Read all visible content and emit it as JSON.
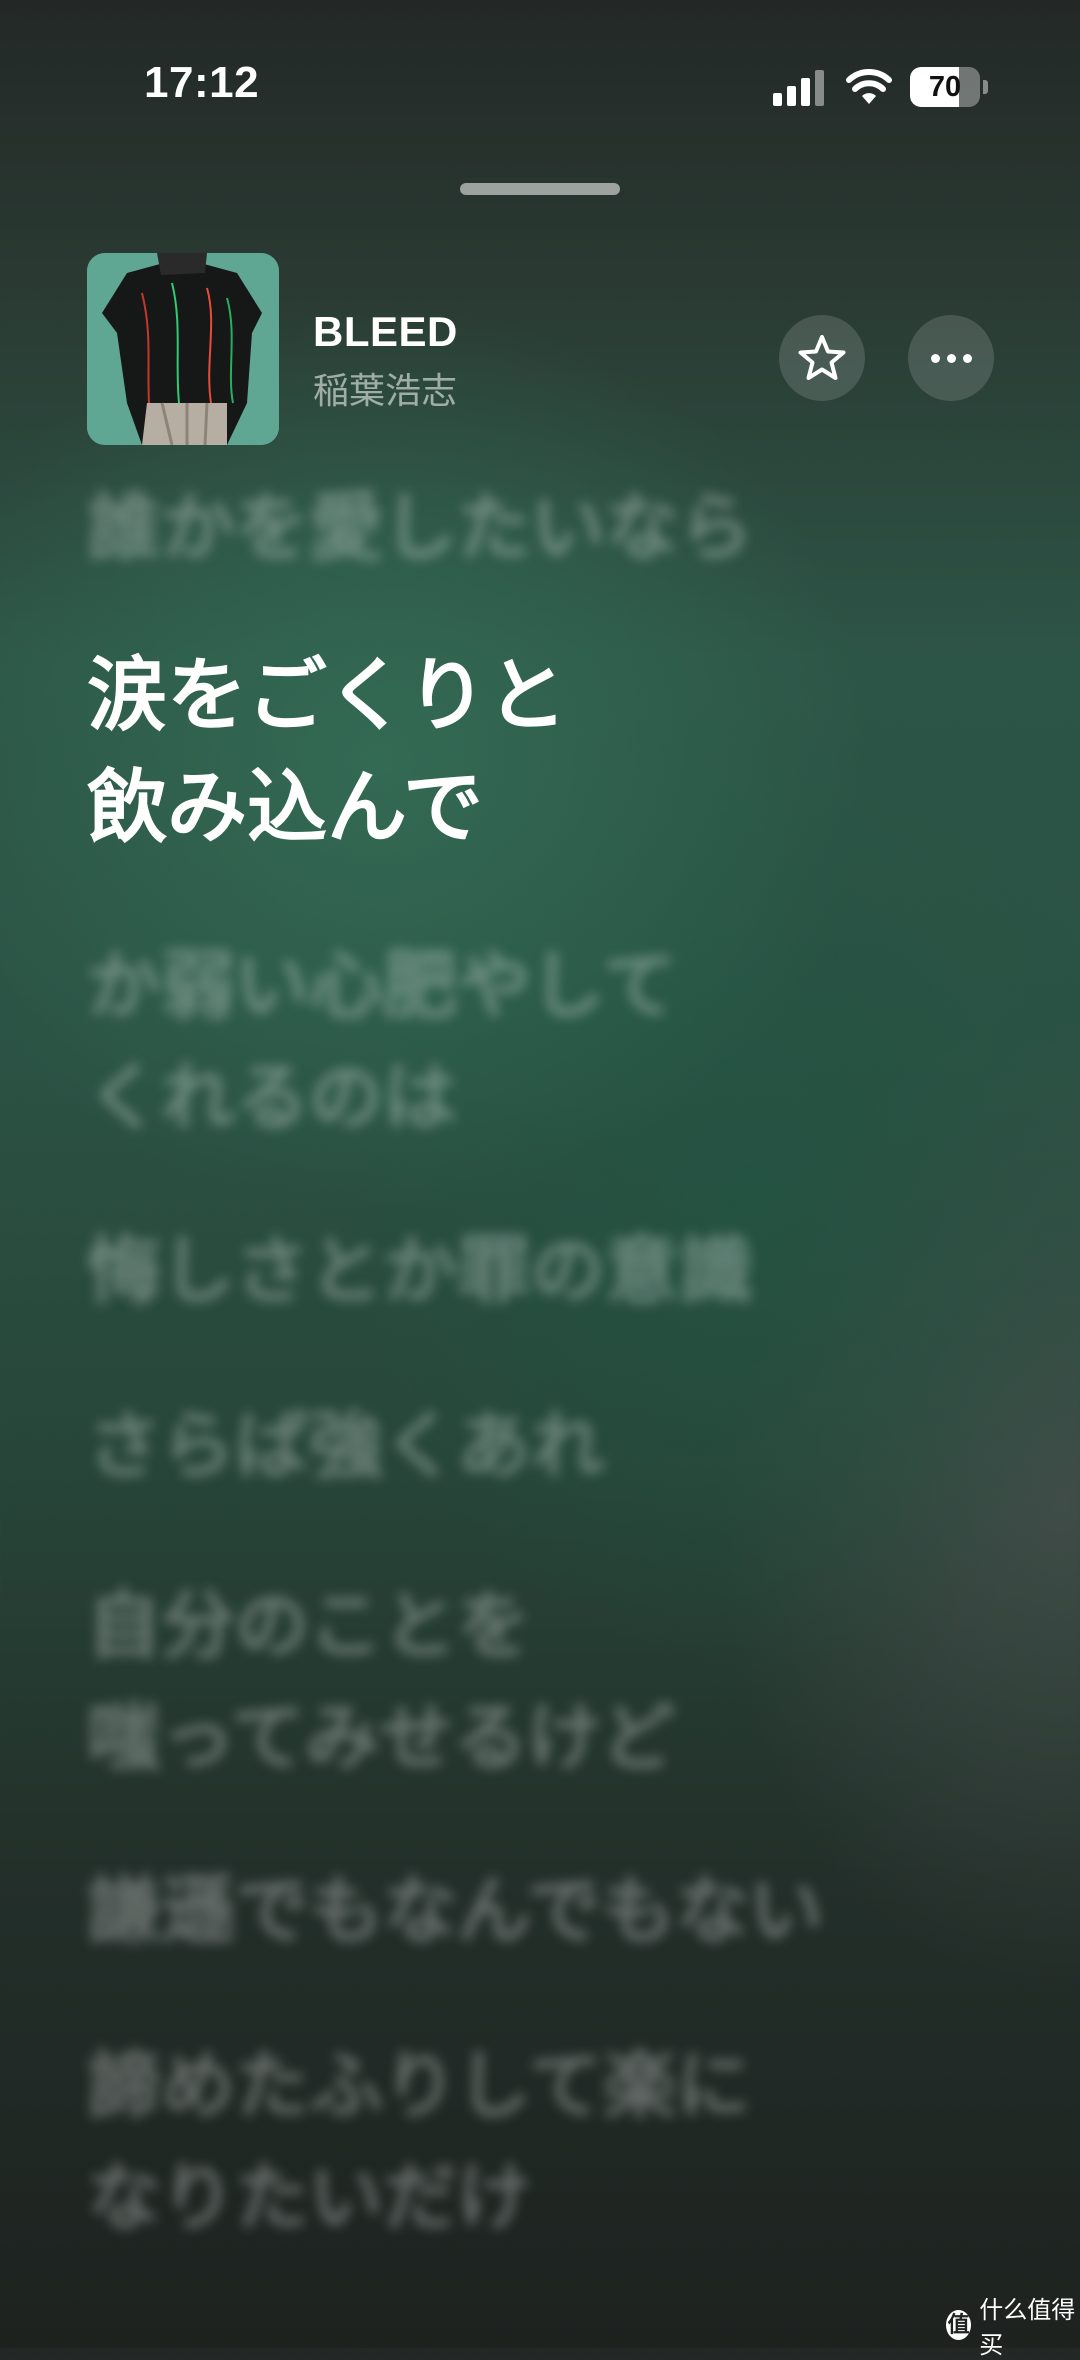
{
  "status_bar": {
    "time": "17:12",
    "battery_level": 70,
    "battery_fraction": 0.7,
    "signal_bars_active": 3,
    "signal_bars_total": 4,
    "icons": [
      "signal-icon",
      "wifi-icon",
      "battery-icon"
    ]
  },
  "now_playing": {
    "title": "BLEED",
    "artist": "稲葉浩志",
    "favorite_icon": "star-outline-icon",
    "more_icon": "ellipsis-icon"
  },
  "lyrics": {
    "lines": [
      "誰かを愛したいなら",
      "涙をごくりと\n飲み込んで",
      "か弱い心肥やして\nくれるのは",
      "悔しさとか罪の意識",
      "さらば強くあれ",
      "自分のことを\n嗤ってみせるけど",
      "謙遜でもなんでもない",
      "諦めたふりして楽に\nなりたいだけ"
    ],
    "active_index": 1
  },
  "watermark": {
    "logo_text": "值",
    "text": "什么值得买"
  },
  "colors": {
    "background_green": "#2d5547",
    "background_dark": "#1d221f",
    "active_text": "#ffffff",
    "inactive_text": "rgba(255,255,255,0.32)"
  }
}
